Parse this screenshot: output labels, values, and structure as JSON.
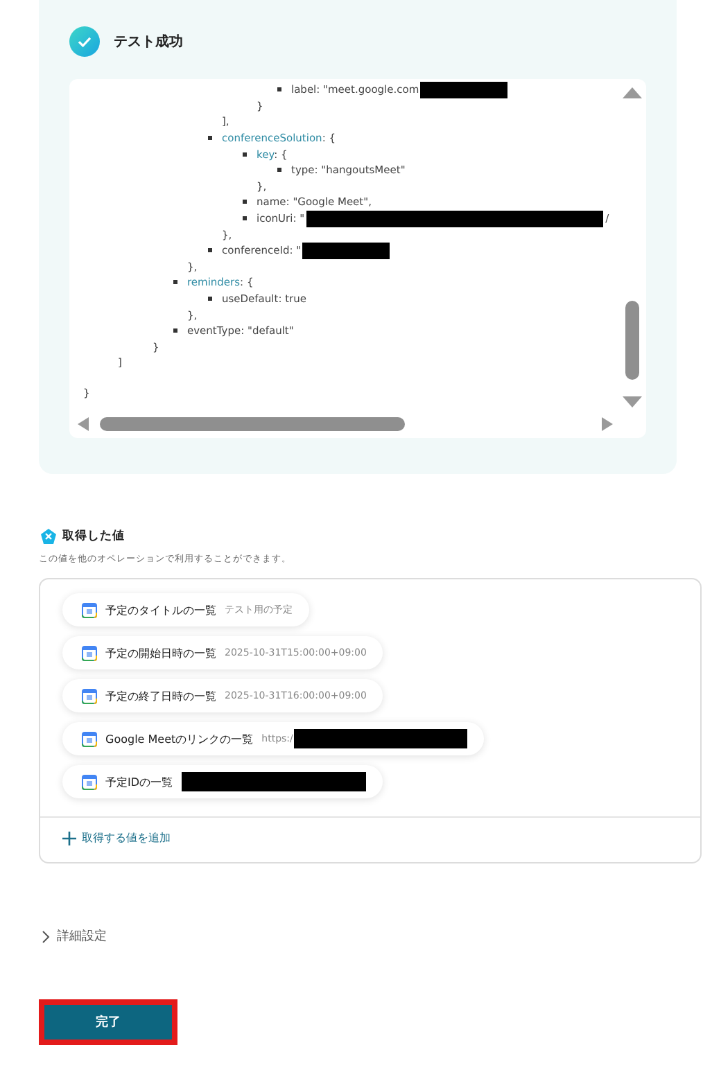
{
  "test_result": {
    "title": "テスト成功",
    "success": true,
    "code": [
      {
        "kind": "group",
        "close": "}",
        "children": [
          {
            "kind": "group",
            "close": "]",
            "children": [
              {
                "kind": "group",
                "close": "}",
                "children": [
                  {
                    "kind": "group",
                    "close": "},",
                    "children": [
                      {
                        "kind": "group",
                        "close": "],",
                        "children": [
                          {
                            "kind": "group",
                            "close": "}",
                            "children": [
                              {
                                "kind": "item",
                                "key": "label",
                                "object": false,
                                "value": ": \"meet.google.com",
                                "redacted": true
                              }
                            ]
                          }
                        ]
                      },
                      {
                        "kind": "item",
                        "key": "conferenceSolution",
                        "object": true,
                        "value": ": {",
                        "close": "},",
                        "children": [
                          {
                            "kind": "item",
                            "key": "key",
                            "object": true,
                            "value": ": {",
                            "close": "},",
                            "children": [
                              {
                                "kind": "item",
                                "key": "type",
                                "object": false,
                                "value": ": \"hangoutsMeet\""
                              }
                            ]
                          },
                          {
                            "kind": "item",
                            "key": "name",
                            "object": false,
                            "value": ": \"Google Meet\","
                          },
                          {
                            "kind": "item",
                            "key": "iconUri",
                            "object": false,
                            "value": ": \"",
                            "redacted": true,
                            "tail": "/"
                          }
                        ]
                      },
                      {
                        "kind": "item",
                        "key": "conferenceId",
                        "object": false,
                        "value": ": \"",
                        "redacted": true
                      }
                    ]
                  },
                  {
                    "kind": "item",
                    "key": "reminders",
                    "object": true,
                    "value": ": {",
                    "close": "},",
                    "children": [
                      {
                        "kind": "item",
                        "key": "useDefault",
                        "object": false,
                        "value": ": true"
                      }
                    ]
                  },
                  {
                    "kind": "item",
                    "key": "eventType",
                    "object": false,
                    "value": ": \"default\""
                  }
                ]
              }
            ]
          }
        ]
      }
    ]
  },
  "outputs": {
    "title": "取得した値",
    "description": "この値を他のオペレーションで利用することができます。",
    "items": [
      {
        "label": "予定のタイトルの一覧",
        "value": "テスト用の予定",
        "redacted": false
      },
      {
        "label": "予定の開始日時の一覧",
        "value": "2025-10-31T15:00:00+09:00",
        "redacted": false
      },
      {
        "label": "予定の終了日時の一覧",
        "value": "2025-10-31T16:00:00+09:00",
        "redacted": false
      },
      {
        "label": "Google Meetのリンクの一覧",
        "value": "https:/",
        "redacted": true
      },
      {
        "label": "予定IDの一覧",
        "redacted": true
      }
    ],
    "add_button": "取得する値を追加"
  },
  "details": {
    "label": "詳細設定",
    "expanded": false
  },
  "submit": {
    "label": "完了",
    "highlighted": true
  }
}
